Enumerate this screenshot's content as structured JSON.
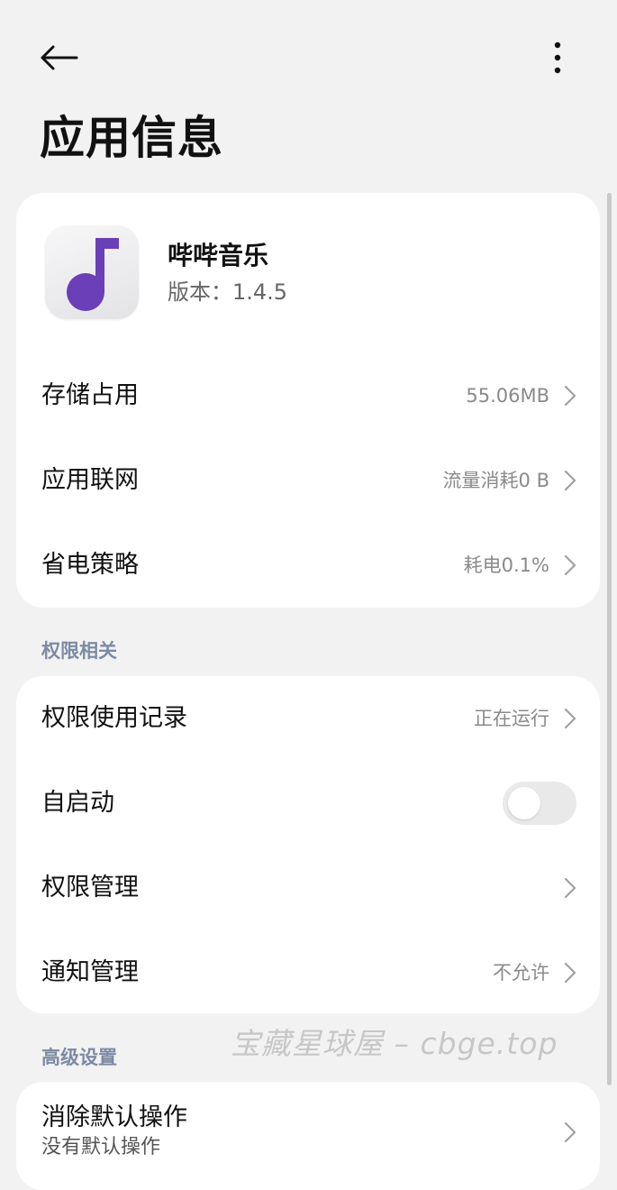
{
  "header": {
    "back_icon": "arrow-left-icon",
    "more_icon": "more-vertical-icon",
    "title": "应用信息"
  },
  "app": {
    "icon": "music-note-icon",
    "icon_color": "#6a3fb7",
    "name": "哔哔音乐",
    "version": "版本：1.4.5"
  },
  "app_rows": [
    {
      "label": "存储占用",
      "value": "55.06MB"
    },
    {
      "label": "应用联网",
      "value": "流量消耗0 B"
    },
    {
      "label": "省电策略",
      "value": "耗电0.1%"
    }
  ],
  "permissions_section": {
    "title": "权限相关",
    "rows": [
      {
        "label": "权限使用记录",
        "value": "正在运行"
      },
      {
        "label": "自启动",
        "toggle_on": false
      },
      {
        "label": "权限管理",
        "value": ""
      },
      {
        "label": "通知管理",
        "value": "不允许"
      }
    ]
  },
  "advanced_section": {
    "title": "高级设置",
    "rows": [
      {
        "label": "消除默认操作",
        "subtitle": "没有默认操作"
      }
    ]
  },
  "watermark": "宝藏星球屋 – cbge.top",
  "colors": {
    "background": "#f2f2f2",
    "card": "#ffffff",
    "section_label": "#7d8aa3",
    "secondary_text": "#8a8a8a"
  }
}
